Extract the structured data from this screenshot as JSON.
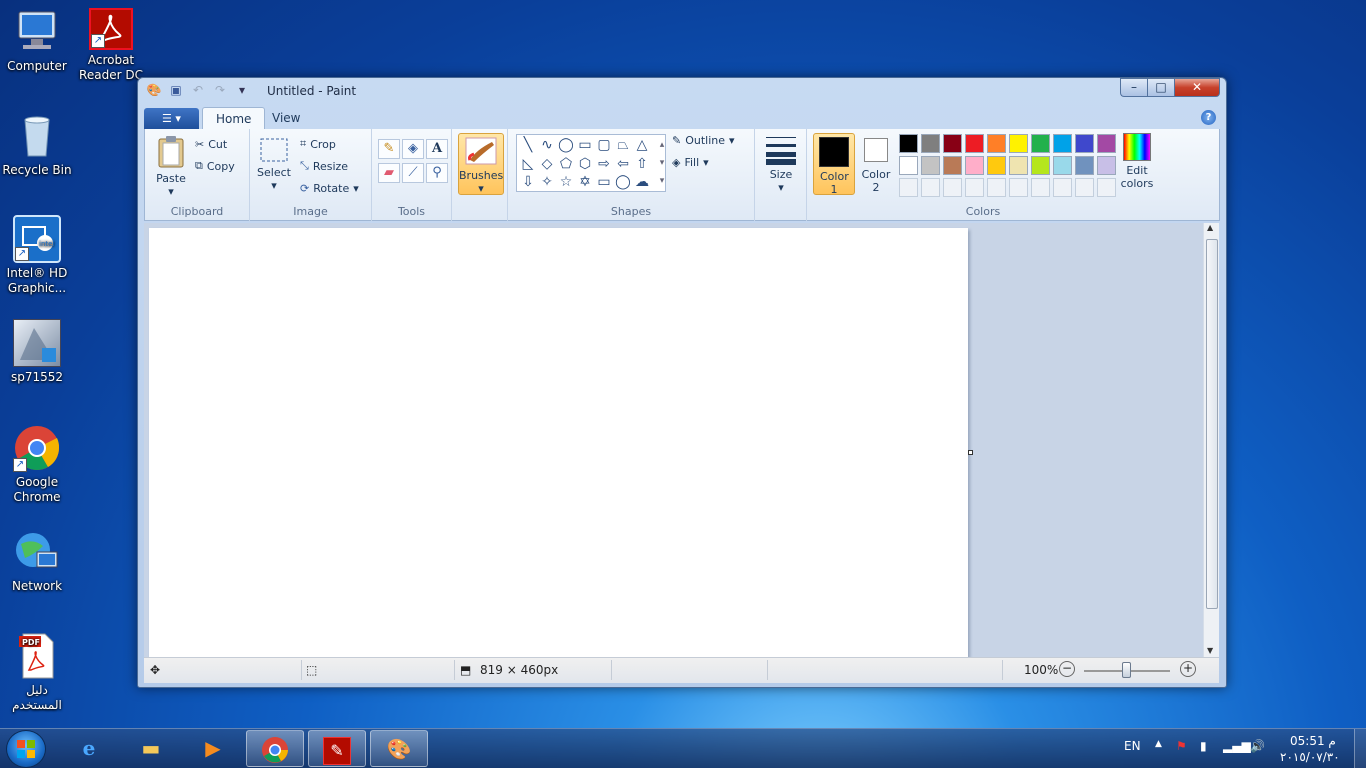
{
  "desktop": {
    "icons": [
      {
        "label": "Computer"
      },
      {
        "label": "Acrobat Reader DC"
      },
      {
        "label": "Recycle Bin"
      },
      {
        "label": "Intel® HD Graphic..."
      },
      {
        "label": "sp71552"
      },
      {
        "label": "Google Chrome"
      },
      {
        "label": "Network"
      },
      {
        "label": "دليل المستخدم"
      }
    ]
  },
  "window": {
    "title": "Untitled - Paint",
    "controls": {
      "minimize": "–",
      "maximize": "□",
      "close": "✕"
    }
  },
  "ribbon": {
    "tabs": [
      {
        "label": "Home"
      },
      {
        "label": "View"
      }
    ],
    "help": "?",
    "clipboard": {
      "paste": "Paste",
      "cut": "Cut",
      "copy": "Copy",
      "group": "Clipboard"
    },
    "image": {
      "select": "Select",
      "crop": "Crop",
      "resize": "Resize",
      "rotate": "Rotate",
      "group": "Image"
    },
    "tools": {
      "group": "Tools",
      "text_glyph": "A"
    },
    "brushes": {
      "label": "Brushes"
    },
    "shapes": {
      "outline": "Outline",
      "fill": "Fill",
      "group": "Shapes"
    },
    "size": {
      "label": "Size"
    },
    "colors": {
      "color1": "Color 1",
      "color2": "Color 2",
      "edit": "Edit colors",
      "group": "Colors",
      "color1_value": "#000000",
      "color2_value": "#ffffff",
      "palette_row1": [
        "#000000",
        "#7f7f7f",
        "#880015",
        "#ed1c24",
        "#ff7f27",
        "#fff200",
        "#22b14c",
        "#00a2e8",
        "#3f48cc",
        "#a349a4"
      ],
      "palette_row2": [
        "#ffffff",
        "#c3c3c3",
        "#b97a57",
        "#ffaec9",
        "#ffc90e",
        "#efe4b0",
        "#b5e61d",
        "#99d9ea",
        "#7092be",
        "#c8bfe7"
      ]
    }
  },
  "statusbar": {
    "dimensions": "819 × 460px",
    "zoom": "100%"
  },
  "taskbar": {
    "language": "EN",
    "time": "05:51 م",
    "date": "٢٠١٥/٠٧/٣٠"
  }
}
